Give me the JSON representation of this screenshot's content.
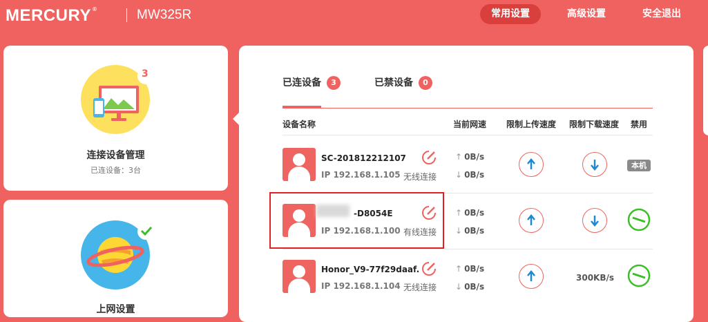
{
  "header": {
    "brand": "MERCURY",
    "trademark": "®",
    "model": "MW325R",
    "nav": [
      {
        "label": "常用设置",
        "active": true
      },
      {
        "label": "高级设置",
        "active": false
      },
      {
        "label": "安全退出",
        "active": false
      }
    ]
  },
  "left_cards": {
    "devices": {
      "title": "连接设备管理",
      "subtitle": "已连设备：3台",
      "count": "3"
    },
    "internet": {
      "title": "上网设置",
      "status": "check"
    }
  },
  "tabs": [
    {
      "label": "已连设备",
      "count": "3",
      "active": true
    },
    {
      "label": "已禁设备",
      "count": "0",
      "active": false
    }
  ],
  "columns": {
    "name": "设备名称",
    "speed": "当前网速",
    "upload_limit": "限制上传速度",
    "download_limit": "限制下载速度",
    "ban": "禁用"
  },
  "devices": [
    {
      "name": "SC-201812212107",
      "ip": "IP 192.168.1.105",
      "connection": "无线连接",
      "up": "0B/s",
      "down": "0B/s",
      "download_limit": "",
      "ban": "本机"
    },
    {
      "name": "-D8054E",
      "ip": "IP 192.168.1.100",
      "connection": "有线连接",
      "up": "0B/s",
      "down": "0B/s",
      "download_limit": "",
      "ban": ""
    },
    {
      "name": "Honor_V9-77f29daaf.",
      "ip": "IP 192.168.1.104",
      "connection": "无线连接",
      "up": "0B/s",
      "down": "0B/s",
      "download_limit": "300KB/s",
      "ban": ""
    }
  ],
  "colors": {
    "brand": "#f0625f",
    "active_nav": "#d9403d",
    "upload_arrow": "#1e88d2",
    "ban_green": "#3bbf26",
    "highlight_box": "#e02020"
  }
}
